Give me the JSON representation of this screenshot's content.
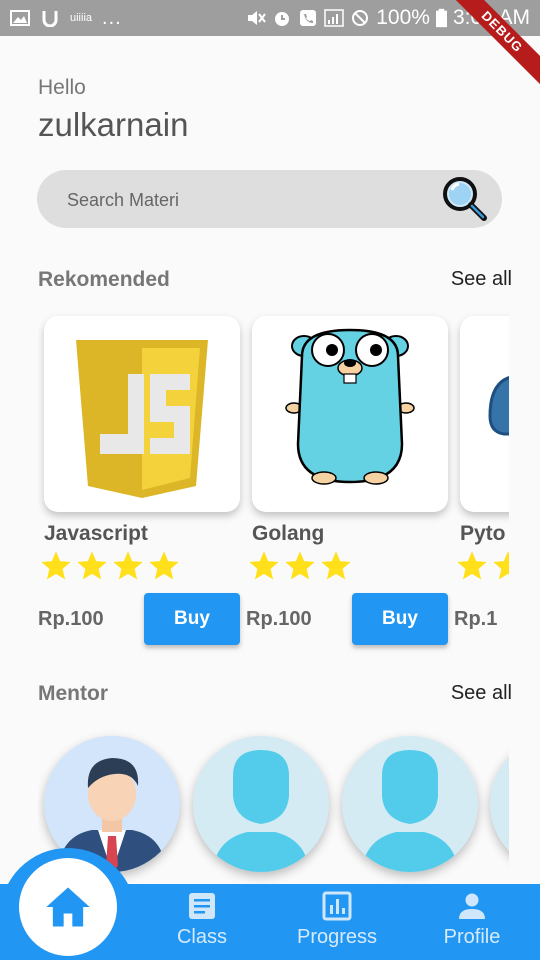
{
  "status_bar": {
    "notification_text": "uiiiia",
    "dots": "...",
    "battery": "100%",
    "time": "3:02 AM",
    "debug_label": "DEBUG"
  },
  "greeting": {
    "hello": "Hello",
    "username": "zulkarnain"
  },
  "search": {
    "placeholder": "Search Materi",
    "icon": "search-icon"
  },
  "recommended": {
    "title": "Rekomended",
    "see_all": "See all",
    "courses": [
      {
        "name": "Javascript",
        "stars": 4,
        "price": "Rp.100",
        "buy": "Buy",
        "icon": "javascript-logo"
      },
      {
        "name": "Golang",
        "stars": 3,
        "price": "Rp.100",
        "buy": "Buy",
        "icon": "golang-gopher"
      },
      {
        "name": "Pyto",
        "stars": 2,
        "price": "Rp.1",
        "icon": "python-logo"
      }
    ]
  },
  "mentor": {
    "title": "Mentor",
    "see_all": "See all"
  },
  "bottom_nav": {
    "items": [
      {
        "label": "Class",
        "icon": "document-icon"
      },
      {
        "label": "Progress",
        "icon": "chart-icon"
      },
      {
        "label": "Profile",
        "icon": "person-icon"
      }
    ],
    "home_icon": "home-icon"
  },
  "colors": {
    "accent": "#2196f3",
    "star": "#ffe01b",
    "debug": "#b71c1c"
  }
}
